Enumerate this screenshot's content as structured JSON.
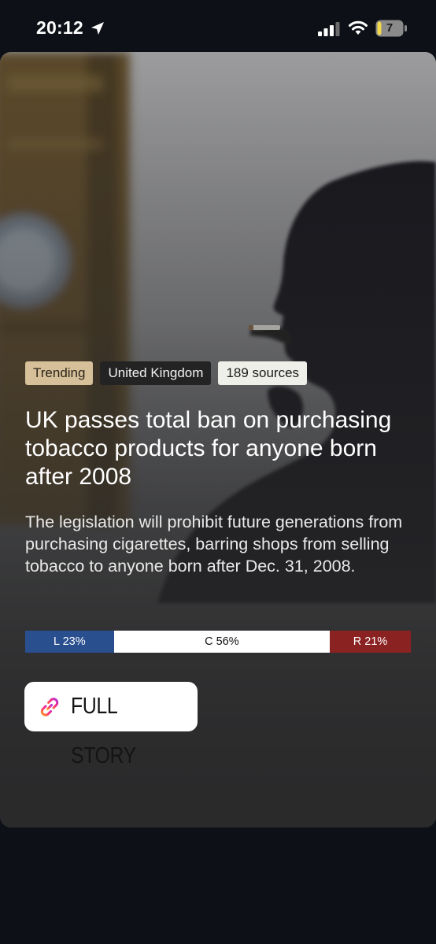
{
  "status_bar": {
    "time": "20:12",
    "battery_level": "7",
    "icons": [
      "location-arrow-icon",
      "cellular-signal-icon",
      "wifi-icon",
      "battery-icon"
    ]
  },
  "story": {
    "image": "man-smoking-cigarette-near-big-ben-photo",
    "tags": {
      "trending": "Trending",
      "region": "United Kingdom",
      "sources": "189 sources"
    },
    "headline": "UK passes total ban on purchasing tobacco products for anyone born after 2008",
    "summary": "The legislation will prohibit future generations from purchasing cigarettes, barring shops from selling tobacco to anyone born after Dec. 31, 2008.",
    "bias": {
      "left": {
        "label": "L 23%",
        "value": 23,
        "color": "#2a4f8f"
      },
      "center": {
        "label": "C 56%",
        "value": 56,
        "color": "#ffffff"
      },
      "right": {
        "label": "R 21%",
        "value": 21,
        "color": "#8b2222"
      }
    },
    "cta_label": "FULL STORY"
  }
}
